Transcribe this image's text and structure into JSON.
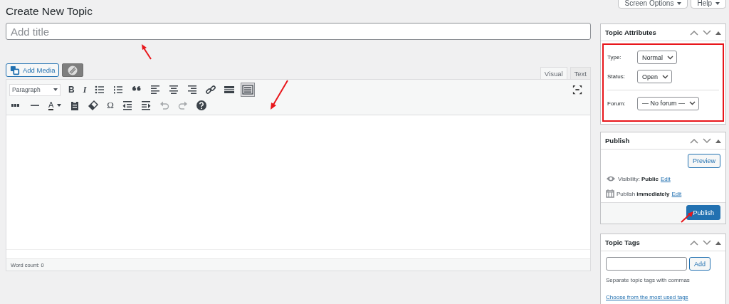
{
  "header": {
    "title": "Create New Topic",
    "buttons": [
      {
        "label": "Screen Options"
      },
      {
        "label": "Help"
      }
    ]
  },
  "title_field": {
    "placeholder": "Add title"
  },
  "editor": {
    "add_media": "Add Media",
    "tabs": [
      {
        "label": "Visual",
        "selected": true
      },
      {
        "label": "Text",
        "selected": false
      }
    ],
    "toolbar_rows": [
      [
        {
          "kind": "select",
          "text": "Paragraph"
        },
        {
          "kind": "bold",
          "text": "B"
        },
        {
          "kind": "italic",
          "text": "I"
        },
        {
          "kind": "bullets"
        },
        {
          "kind": "numbers"
        },
        {
          "kind": "quote"
        },
        {
          "kind": "left"
        },
        {
          "kind": "center"
        },
        {
          "kind": "right"
        },
        {
          "kind": "link"
        },
        {
          "kind": "more"
        },
        {
          "kind": "toggle"
        }
      ],
      [
        {
          "kind": "strike"
        },
        {
          "kind": "hr"
        },
        {
          "kind": "color",
          "text": "A"
        },
        {
          "kind": "paste"
        },
        {
          "kind": "eraser"
        },
        {
          "kind": "glyph",
          "text": "Ω"
        },
        {
          "kind": "outdent"
        },
        {
          "kind": "indent"
        },
        {
          "kind": "undo"
        },
        {
          "kind": "redo"
        },
        {
          "kind": "help"
        }
      ]
    ],
    "word_count": "Word count: 0"
  },
  "sidebar": {
    "attributes": {
      "title": "Topic Attributes",
      "highlighted": true,
      "fields": [
        {
          "label": "Type:",
          "value": "Normal"
        },
        {
          "label": "Status:",
          "value": "Open"
        },
        {
          "label": "Forum:",
          "value": "— No forum —"
        }
      ]
    },
    "publish": {
      "title": "Publish",
      "preview": "Preview",
      "visibility_label": "Visibility:",
      "visibility": "Public",
      "publish_label": "Publish",
      "publish_when": "immediately",
      "visibility_edit": "Edit",
      "publish_edit": "Edit",
      "button": "Publish"
    },
    "tags": {
      "title": "Topic Tags",
      "add": "Add",
      "hint": "Separate topic tags with commas",
      "link": "Choose from the most used tags"
    }
  }
}
